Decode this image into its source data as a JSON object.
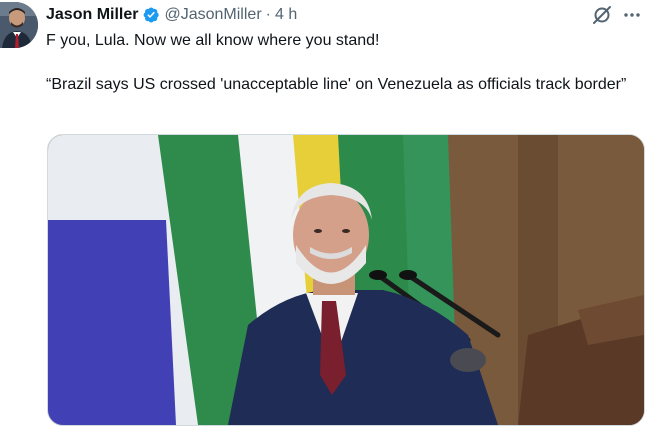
{
  "post": {
    "author_name": "Jason Miller",
    "author_handle": "@JasonMiller",
    "separator": "·",
    "timestamp": "4 h",
    "verified": true,
    "text_line1": "F you, Lula. Now we all know where you stand!",
    "text_quote": "“Brazil says US crossed 'unacceptable line' on Venezuela as officials track border”"
  },
  "icons": {
    "verified": "verified-badge-icon",
    "grok": "grok-icon",
    "more": "more-options-icon"
  },
  "colors": {
    "verified_blue": "#1d9bf0",
    "secondary_text": "#536471",
    "primary_text": "#0f1419"
  }
}
